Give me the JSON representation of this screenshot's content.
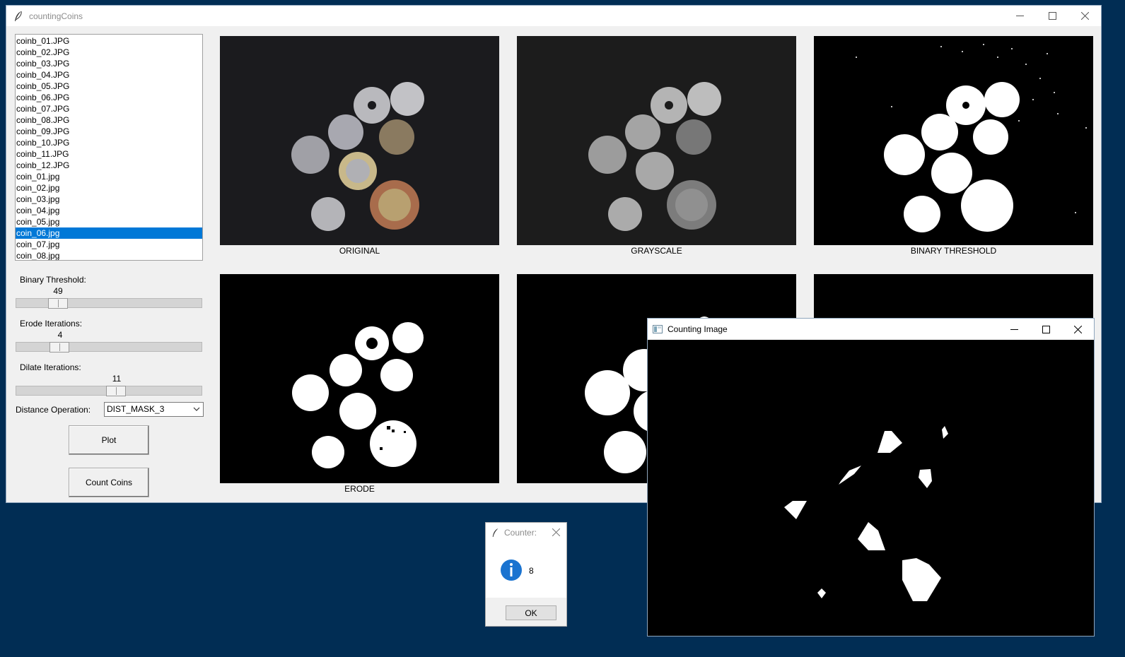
{
  "main_window": {
    "title": "countingCoins",
    "files": [
      "coinb_01.JPG",
      "coinb_02.JPG",
      "coinb_03.JPG",
      "coinb_04.JPG",
      "coinb_05.JPG",
      "coinb_06.JPG",
      "coinb_07.JPG",
      "coinb_08.JPG",
      "coinb_09.JPG",
      "coinb_10.JPG",
      "coinb_11.JPG",
      "coinb_12.JPG",
      "coin_01.jpg",
      "coin_02.jpg",
      "coin_03.jpg",
      "coin_04.jpg",
      "coin_05.jpg",
      "coin_06.jpg",
      "coin_07.jpg",
      "coin_08.jpg"
    ],
    "selected_file": "coin_06.jpg",
    "binary_threshold_label": "Binary Threshold:",
    "binary_threshold_value": "49",
    "erode_label": "Erode Iterations:",
    "erode_value": "4",
    "dilate_label": "Dilate Iterations:",
    "dilate_value": "11",
    "distance_label": "Distance Operation:",
    "distance_value": "DIST_MASK_3",
    "plot_button": "Plot",
    "count_button": "Count Coins",
    "captions": [
      "ORIGINAL",
      "GRAYSCALE",
      "BINARY THRESHOLD",
      "ERODE",
      "D"
    ]
  },
  "counting_window": {
    "title": "Counting Image"
  },
  "dialog": {
    "title": "Counter:",
    "message": "8",
    "ok_label": "OK"
  },
  "colors": {
    "selection": "#0078d7",
    "desktop": "#012d54",
    "info_icon": "#1a73d0"
  }
}
